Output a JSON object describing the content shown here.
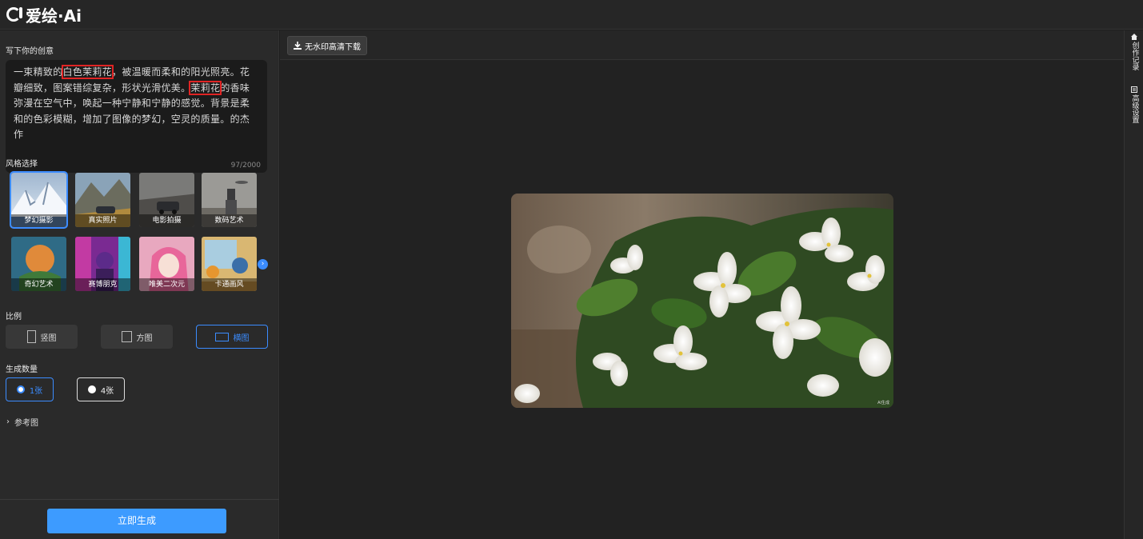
{
  "app": {
    "logo_text": "爱绘·Ai"
  },
  "left": {
    "prompt_title": "写下你的创意",
    "prompt": {
      "seg1": "一束精致的",
      "hl1": "白色茉莉花",
      "seg2": "，被温暖而柔和的阳光照亮。花瓣细致，图案错综复杂，形状光滑优美。",
      "hl2": "茉莉花",
      "seg3": "的香味弥漫在空气中，唤起一种宁静和宁静的感觉。背景是柔和的色彩模糊，增加了图像的梦幻，空灵的质量。的杰作",
      "count": "97/2000"
    },
    "style_title": "风格选择",
    "styles": [
      {
        "label": "梦幻摄影",
        "active": true
      },
      {
        "label": "真实照片",
        "active": false
      },
      {
        "label": "电影拍摄",
        "active": false
      },
      {
        "label": "数码艺术",
        "active": false
      },
      {
        "label": "奇幻艺术",
        "active": false
      },
      {
        "label": "赛博朋克",
        "active": false
      },
      {
        "label": "唯美二次元",
        "active": false
      },
      {
        "label": "卡通画风",
        "active": false
      }
    ],
    "ratio_title": "比例",
    "ratios": [
      {
        "label": "竖图",
        "active": false
      },
      {
        "label": "方图",
        "active": false
      },
      {
        "label": "横图",
        "active": true
      }
    ],
    "count_title": "生成数量",
    "counts": [
      {
        "label": "1张",
        "active": true
      },
      {
        "label": "4张",
        "active": false
      }
    ],
    "ref_label": "参考图",
    "generate_label": "立即生成"
  },
  "main": {
    "download_label": "无水印高清下载",
    "watermark": "AI生成"
  },
  "rail": {
    "history": "创作记录",
    "advanced": "高级设置"
  },
  "colors": {
    "accent": "#3b8cff",
    "highlight": "#e02424",
    "generate": "#3d9bff"
  }
}
